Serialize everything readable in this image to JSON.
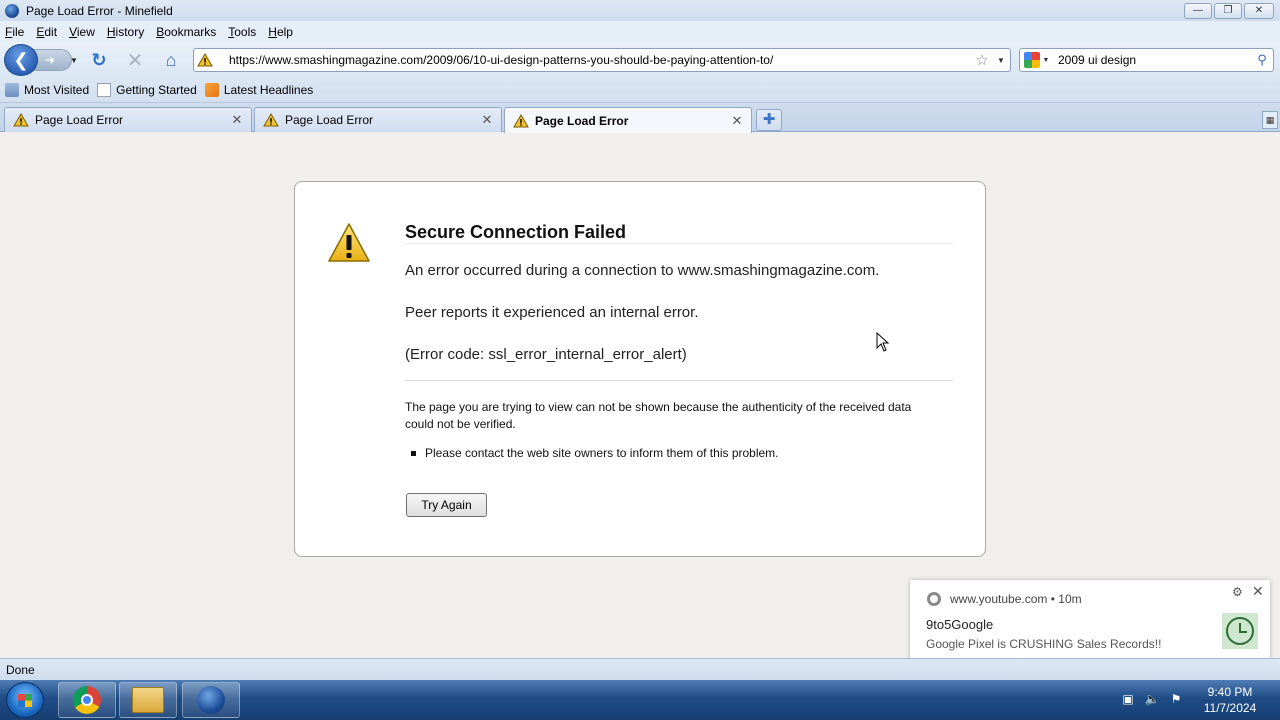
{
  "window": {
    "title": "Page Load Error - Minefield",
    "controls": {
      "minimize": "—",
      "maximize": "❐",
      "close": "✕"
    }
  },
  "menu": [
    "File",
    "Edit",
    "View",
    "History",
    "Bookmarks",
    "Tools",
    "Help"
  ],
  "nav": {
    "url": "https://www.smashingmagazine.com/2009/06/10-ui-design-patterns-you-should-be-paying-attention-to/",
    "search_query": "2009 ui design"
  },
  "bookmarks": [
    {
      "label": "Most Visited",
      "icon": "most-visited-icon"
    },
    {
      "label": "Getting Started",
      "icon": "page-icon"
    },
    {
      "label": "Latest Headlines",
      "icon": "rss-icon"
    }
  ],
  "tabs": [
    {
      "label": "Page Load Error",
      "active": false
    },
    {
      "label": "Page Load Error",
      "active": false
    },
    {
      "label": "Page Load Error",
      "active": true
    }
  ],
  "error": {
    "title": "Secure Connection Failed",
    "line1": "An error occurred during a connection to www.smashingmagazine.com.",
    "line2": "Peer reports it experienced an internal error.",
    "line3": "(Error code: ssl_error_internal_error_alert)",
    "detail": "The page you are trying to view can not be shown because the authenticity of the received data could not be verified.",
    "bullet": "Please contact the web site owners to inform them of this problem.",
    "button": "Try Again"
  },
  "notification": {
    "source": "www.youtube.com",
    "age": "10m",
    "title": "9to5Google",
    "body": "Google Pixel is CRUSHING Sales Records!!"
  },
  "status": "Done",
  "clock": {
    "time": "9:40 PM",
    "date": "11/7/2024"
  },
  "colors": {
    "accent": "#2a5fb5",
    "warning": "#f2c230",
    "taskbar": "#1f4c86"
  }
}
